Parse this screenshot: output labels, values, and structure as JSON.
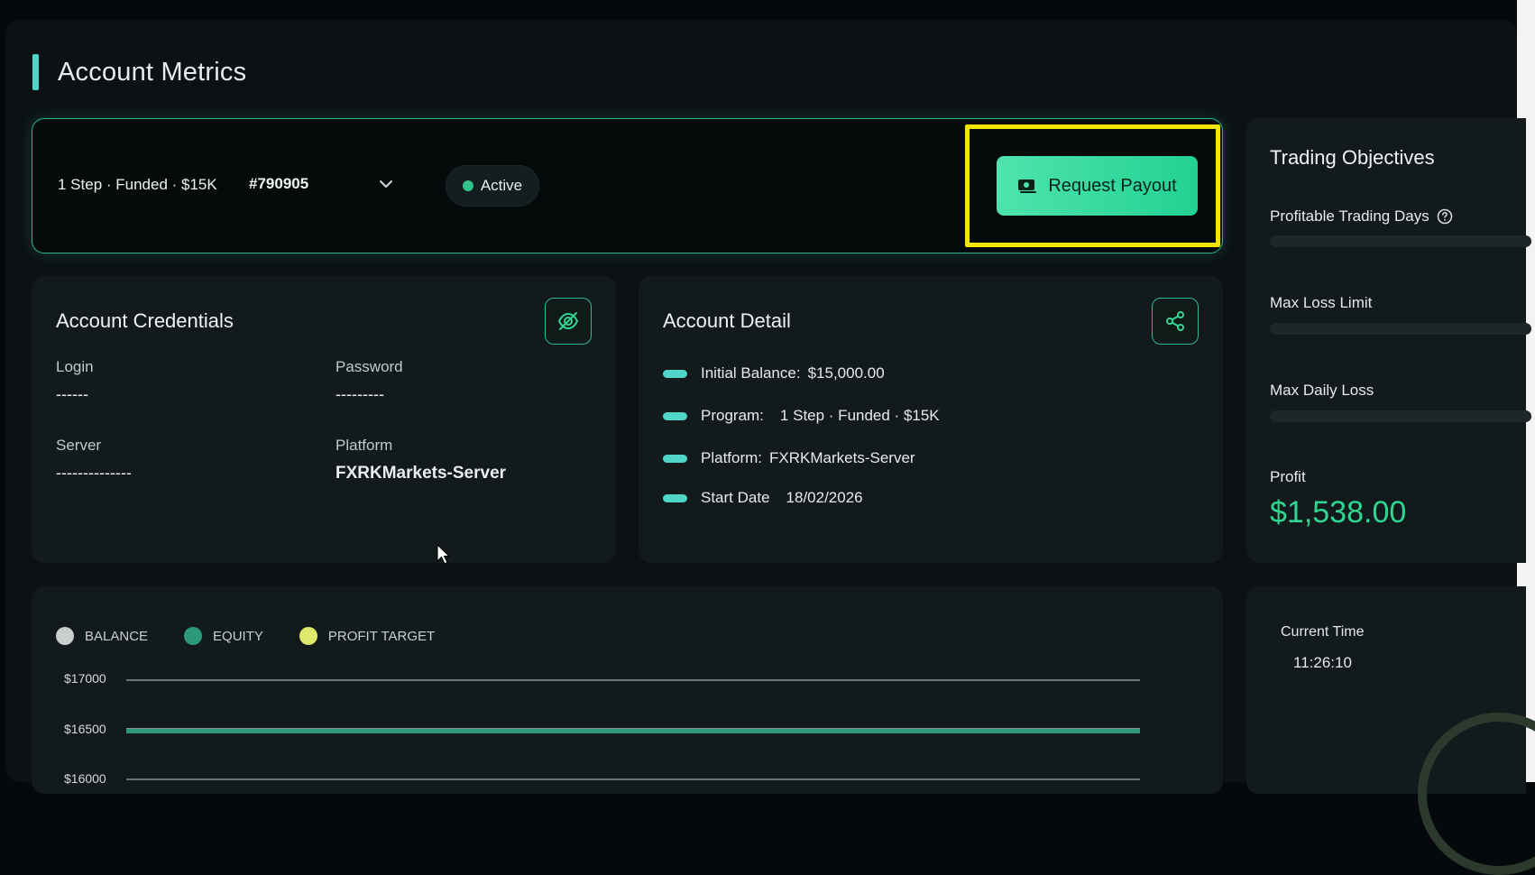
{
  "page": {
    "title": "Account Metrics"
  },
  "account": {
    "program": "1 Step · Funded · $15K",
    "id": "#790905",
    "status": "Active",
    "status_color": "#31c48a",
    "payout_button": "Request Payout"
  },
  "credentials": {
    "title": "Account Credentials",
    "toggle_icon": "eye-off-icon",
    "login_label": "Login",
    "login_value": "------",
    "password_label": "Password",
    "password_value": "---------",
    "server_label": "Server",
    "server_value": "--------------",
    "platform_label": "Platform",
    "platform_value": "FXRKMarkets-Server"
  },
  "detail": {
    "title": "Account Detail",
    "share_icon": "share-icon",
    "rows": [
      {
        "label": "Initial Balance:",
        "value": "$15,000.00"
      },
      {
        "label": "Program:",
        "value": "1 Step · Funded · $15K"
      },
      {
        "label": "Platform:",
        "value": "FXRKMarkets-Server"
      },
      {
        "label": "Start Date",
        "value": "18/02/2026"
      }
    ]
  },
  "objectives": {
    "title": "Trading Objectives",
    "items": [
      "Profitable Trading Days",
      "Max Loss Limit",
      "Max Daily Loss"
    ],
    "profit_label": "Profit",
    "profit_value": "$1,538.00",
    "profit_color": "#2fd691"
  },
  "chart": {
    "legend": [
      {
        "name": "BALANCE",
        "color": "#c9cdce"
      },
      {
        "name": "EQUITY",
        "color": "#2b9a79"
      },
      {
        "name": "PROFIT TARGET",
        "color": "#dfe86a"
      }
    ],
    "ticks": [
      "$17000",
      "$16500",
      "$16000"
    ]
  },
  "chart_data": {
    "type": "line",
    "series": [
      {
        "name": "BALANCE",
        "values": [
          16500
        ]
      },
      {
        "name": "EQUITY",
        "values": [
          16500
        ]
      },
      {
        "name": "PROFIT TARGET",
        "values": []
      }
    ],
    "y_ticks": [
      17000,
      16500,
      16000
    ],
    "grid": true,
    "legend_position": "top-left"
  },
  "time": {
    "label": "Current Time",
    "value": "11:26:10"
  }
}
